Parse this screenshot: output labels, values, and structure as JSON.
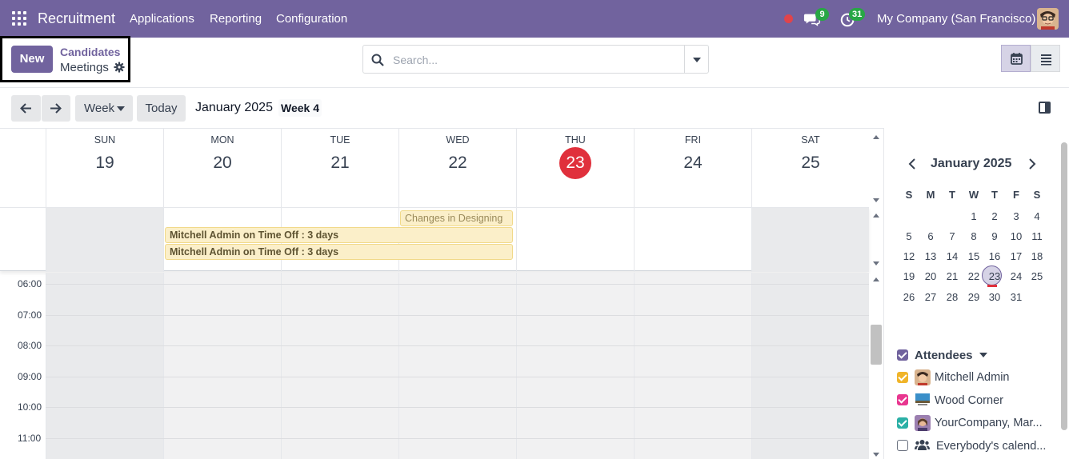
{
  "navbar": {
    "app_name": "Recruitment",
    "menus": [
      "Applications",
      "Reporting",
      "Configuration"
    ],
    "messages_count": "9",
    "activities_count": "31",
    "company": "My Company (San Francisco)"
  },
  "control_panel": {
    "new_label": "New",
    "breadcrumb_parent": "Candidates",
    "breadcrumb_current": "Meetings",
    "search_placeholder": "Search..."
  },
  "toolbar": {
    "scale_label": "Week",
    "today_label": "Today",
    "title": "January 2025",
    "week_label": "Week 4"
  },
  "calendar": {
    "days": [
      {
        "name": "SUN",
        "num": "19"
      },
      {
        "name": "MON",
        "num": "20"
      },
      {
        "name": "TUE",
        "num": "21"
      },
      {
        "name": "WED",
        "num": "22"
      },
      {
        "name": "THU",
        "num": "23",
        "today": true
      },
      {
        "name": "FRI",
        "num": "24"
      },
      {
        "name": "SAT",
        "num": "25"
      }
    ],
    "allday_events": [
      {
        "title": "Changes in Designing"
      },
      {
        "title": "Mitchell Admin on Time Off : 3 days"
      },
      {
        "title": "Mitchell Admin on Time Off : 3 days"
      }
    ],
    "hours": [
      "06:00",
      "07:00",
      "08:00",
      "09:00",
      "10:00",
      "11:00"
    ]
  },
  "mini_calendar": {
    "title": "January 2025",
    "weekday_heads": [
      "S",
      "M",
      "T",
      "W",
      "T",
      "F",
      "S"
    ],
    "weeks": [
      [
        "",
        "",
        "",
        "1",
        "2",
        "3",
        "4"
      ],
      [
        "5",
        "6",
        "7",
        "8",
        "9",
        "10",
        "11"
      ],
      [
        "12",
        "13",
        "14",
        "15",
        "16",
        "17",
        "18"
      ],
      [
        "19",
        "20",
        "21",
        "22",
        "23",
        "24",
        "25"
      ],
      [
        "26",
        "27",
        "28",
        "29",
        "30",
        "31",
        ""
      ]
    ],
    "selected": "23"
  },
  "attendees": {
    "title": "Attendees",
    "items": [
      {
        "name": "Mitchell Admin",
        "color": "#f0b429"
      },
      {
        "name": "Wood Corner",
        "color": "#e8368f"
      },
      {
        "name": "YourCompany, Mar...",
        "color": "#2bb0a6"
      },
      {
        "name": "Everybody's calend...",
        "color": ""
      }
    ]
  },
  "colors": {
    "brand": "#71639e",
    "today": "#e0303c",
    "event_bg": "#fbefc9"
  }
}
